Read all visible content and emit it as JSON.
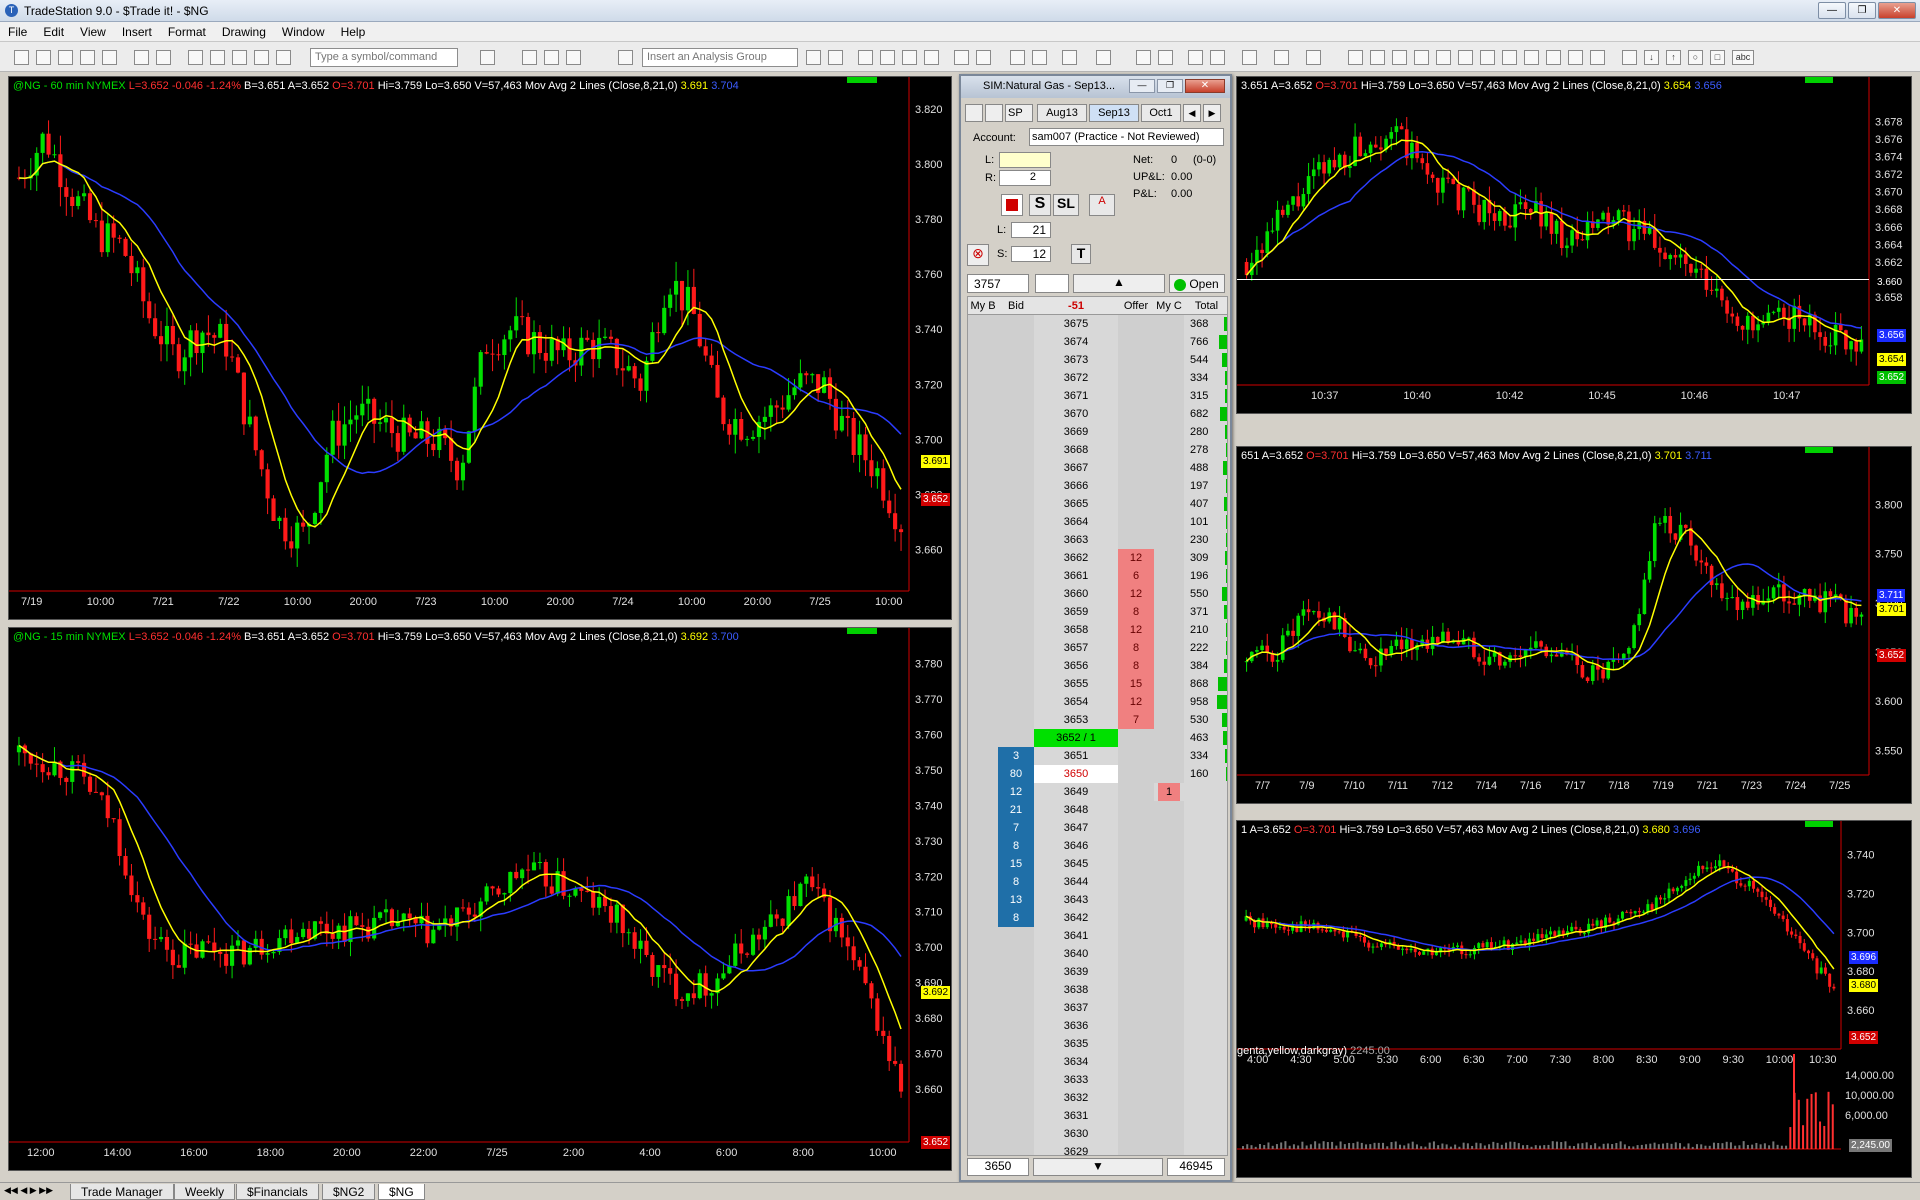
{
  "window": {
    "title": "TradeStation 9.0 - $Trade it! - $NG"
  },
  "menu": [
    "File",
    "Edit",
    "View",
    "Insert",
    "Format",
    "Drawing",
    "Window",
    "Help"
  ],
  "toolbar": {
    "symbol_placeholder": "Type a symbol/command",
    "analysis_placeholder": "Insert an Analysis Group"
  },
  "chart_60": {
    "sym": "@NG - 60 min",
    "exch": "NYMEX",
    "last": "L=3.652",
    "chg": "-0.046",
    "pct": "-1.24%",
    "bid": "B=3.651",
    "ask": "A=3.652",
    "open": "O=3.701",
    "high": "Hi=3.759",
    "low": "Lo=3.650",
    "vol": "V=57,463",
    "study": "Mov Avg 2 Lines (Close,8,21,0)",
    "ma1": "3.691",
    "ma2": "3.704",
    "tag_ma1": "3.691",
    "tag_last": "3.652"
  },
  "chart_15": {
    "sym": "@NG - 15 min",
    "exch": "NYMEX",
    "last": "L=3.652",
    "chg": "-0.046",
    "pct": "-1.24%",
    "bid": "B=3.651",
    "ask": "A=3.652",
    "open": "O=3.701",
    "high": "Hi=3.759",
    "low": "Lo=3.650",
    "vol": "V=57,463",
    "study": "Mov Avg 2 Lines (Close,8,21,0)",
    "ma1": "3.692",
    "ma2": "3.700",
    "tag_ma1": "3.692",
    "tag_last": "3.652"
  },
  "chart_tr": {
    "info": "3.651  A=3.652",
    "open": "O=3.701",
    "rest": "Hi=3.759  Lo=3.650  V=57,463  Mov Avg 2 Lines (Close,8,21,0)",
    "ma1": "3.654",
    "ma2": "3.656",
    "tag_line": "3.660",
    "tag_ma2": "3.656",
    "tag_ma1": "3.654",
    "tag_last": "3.652"
  },
  "chart_mr": {
    "info": "651  A=3.652",
    "open": "O=3.701",
    "rest": "Hi=3.759  Lo=3.650  V=57,463  Mov Avg 2 Lines (Close,8,21,0)",
    "ma1": "3.701",
    "ma2": "3.711",
    "tag_ma2": "3.711",
    "tag_ma1": "3.701",
    "tag_last": "3.652"
  },
  "chart_br": {
    "info": "1  A=3.652",
    "open": "O=3.701",
    "rest": "Hi=3.759  Lo=3.650  V=57,463  Mov Avg 2 Lines (Close,8,21,0)",
    "ma1": "3.680",
    "ma2": "3.696",
    "vol_study": "genta,yellow,darkgray)",
    "vol_val": "2245.00",
    "tag_ma2": "3.696",
    "tag_ma1": "3.680",
    "tag_last": "3.652",
    "tag_vol": "2,245.00"
  },
  "dom": {
    "title": "SIM:Natural Gas - Sep13...",
    "sym": "SP",
    "months": [
      "Aug13",
      "Sep13",
      "Oct1"
    ],
    "account_label": "Account:",
    "account_value": "sam007 (Practice - Not Reviewed)",
    "l_label": "L:",
    "r_label": "R:",
    "r_value": "2",
    "net_label": "Net:",
    "net_value": "0",
    "net_extra": "(0-0)",
    "upl_label": "UP&L:",
    "upl_value": "0.00",
    "pl_label": "P&L:",
    "pl_value": "0.00",
    "s_btn": "S",
    "sl_btn": "SL",
    "qty_l_label": "L:",
    "qty_l": "21",
    "qty_s_label": "S:",
    "qty_s": "12",
    "t_btn": "T",
    "last_price": "3757",
    "open_label": "Open",
    "hdr": {
      "mybid": "My B",
      "bid": "Bid",
      "delta": "-51",
      "offer": "Offer",
      "myoff": "My C",
      "total": "Total"
    },
    "footer_price": "3650",
    "footer_total": "46945"
  },
  "ladder": [
    {
      "p": "3675",
      "t": "368"
    },
    {
      "p": "3674",
      "t": "766"
    },
    {
      "p": "3673",
      "t": "544"
    },
    {
      "p": "3672",
      "t": "334"
    },
    {
      "p": "3671",
      "t": "315"
    },
    {
      "p": "3670",
      "t": "682"
    },
    {
      "p": "3669",
      "t": "280"
    },
    {
      "p": "3668",
      "t": "278"
    },
    {
      "p": "3667",
      "t": "488"
    },
    {
      "p": "3666",
      "t": "197"
    },
    {
      "p": "3665",
      "t": "407"
    },
    {
      "p": "3664",
      "t": "101"
    },
    {
      "p": "3663",
      "t": "230"
    },
    {
      "p": "3662",
      "o": "12",
      "t": "309"
    },
    {
      "p": "3661",
      "o": "6",
      "t": "196"
    },
    {
      "p": "3660",
      "o": "12",
      "t": "550"
    },
    {
      "p": "3659",
      "o": "8",
      "t": "371"
    },
    {
      "p": "3658",
      "o": "12",
      "t": "210"
    },
    {
      "p": "3657",
      "o": "8",
      "t": "222"
    },
    {
      "p": "3656",
      "o": "8",
      "t": "384"
    },
    {
      "p": "3655",
      "o": "15",
      "t": "868"
    },
    {
      "p": "3654",
      "o": "12",
      "t": "958"
    },
    {
      "p": "3653",
      "o": "7",
      "t": "530"
    },
    {
      "p": "3652 / 1",
      "last": true,
      "t": "463"
    },
    {
      "p": "3651",
      "b": "3",
      "t": "334"
    },
    {
      "p": "3650",
      "b": "80",
      "t": "160",
      "hl": true
    },
    {
      "p": "3649",
      "b": "12",
      "mo": "1"
    },
    {
      "p": "3648",
      "b": "21"
    },
    {
      "p": "3647",
      "b": "7"
    },
    {
      "p": "3646",
      "b": "8"
    },
    {
      "p": "3645",
      "b": "15"
    },
    {
      "p": "3644",
      "b": "8"
    },
    {
      "p": "3643",
      "b": "13"
    },
    {
      "p": "3642",
      "b": "8"
    },
    {
      "p": "3641"
    },
    {
      "p": "3640"
    },
    {
      "p": "3639"
    },
    {
      "p": "3638"
    },
    {
      "p": "3637"
    },
    {
      "p": "3636"
    },
    {
      "p": "3635"
    },
    {
      "p": "3634"
    },
    {
      "p": "3633"
    },
    {
      "p": "3632"
    },
    {
      "p": "3631"
    },
    {
      "p": "3630"
    },
    {
      "p": "3629"
    }
  ],
  "tabs": [
    "Trade Manager",
    "Weekly",
    "$Financials",
    "$NG2",
    "$NG"
  ],
  "chart_data": [
    {
      "type": "candlestick",
      "title": "@NG - 60 min",
      "ylim": [
        3.645,
        3.825
      ],
      "yticks": [
        "3.820",
        "3.800",
        "3.780",
        "3.760",
        "3.740",
        "3.720",
        "3.700",
        "3.680",
        "3.660"
      ],
      "xticks": [
        "7/19",
        "10:00",
        "7/21",
        "7/22",
        "10:00",
        "20:00",
        "7/23",
        "10:00",
        "20:00",
        "7/24",
        "10:00",
        "20:00",
        "7/25",
        "10:00"
      ]
    },
    {
      "type": "candlestick",
      "title": "@NG - 15 min",
      "ylim": [
        3.645,
        3.785
      ],
      "yticks": [
        "3.780",
        "3.770",
        "3.760",
        "3.750",
        "3.740",
        "3.730",
        "3.720",
        "3.710",
        "3.700",
        "3.690",
        "3.680",
        "3.670",
        "3.660"
      ],
      "xticks": [
        "12:00",
        "14:00",
        "16:00",
        "18:00",
        "20:00",
        "22:00",
        "7/25",
        "2:00",
        "4:00",
        "6:00",
        "8:00",
        "10:00"
      ]
    },
    {
      "type": "candlestick",
      "ylim": [
        3.648,
        3.681
      ],
      "yticks": [
        "3.678",
        "3.676",
        "3.674",
        "3.672",
        "3.670",
        "3.668",
        "3.666",
        "3.664",
        "3.662",
        "3.660",
        "3.658"
      ],
      "xticks": [
        "10:37",
        "10:40",
        "10:42",
        "10:45",
        "10:46",
        "10:47"
      ]
    },
    {
      "type": "candlestick",
      "ylim": [
        3.525,
        3.84
      ],
      "yticks": [
        "3.800",
        "3.750",
        "3.700",
        "3.650",
        "3.600",
        "3.550"
      ],
      "xticks": [
        "7/7",
        "7/9",
        "7/10",
        "7/11",
        "7/12",
        "7/14",
        "7/16",
        "7/17",
        "7/18",
        "7/19",
        "7/21",
        "7/23",
        "7/24",
        "7/25"
      ]
    },
    {
      "type": "candlestick",
      "ylim": [
        3.64,
        3.75
      ],
      "yticks": [
        "3.740",
        "3.720",
        "3.700",
        "3.680",
        "3.660"
      ],
      "vol_yticks": [
        "14,000.00",
        "10,000.00",
        "6,000.00"
      ],
      "xticks": [
        "4:00",
        "4:30",
        "5:00",
        "5:30",
        "6:00",
        "6:30",
        "7:00",
        "7:30",
        "8:00",
        "8:30",
        "9:00",
        "9:30",
        "10:00",
        "10:30"
      ]
    }
  ]
}
